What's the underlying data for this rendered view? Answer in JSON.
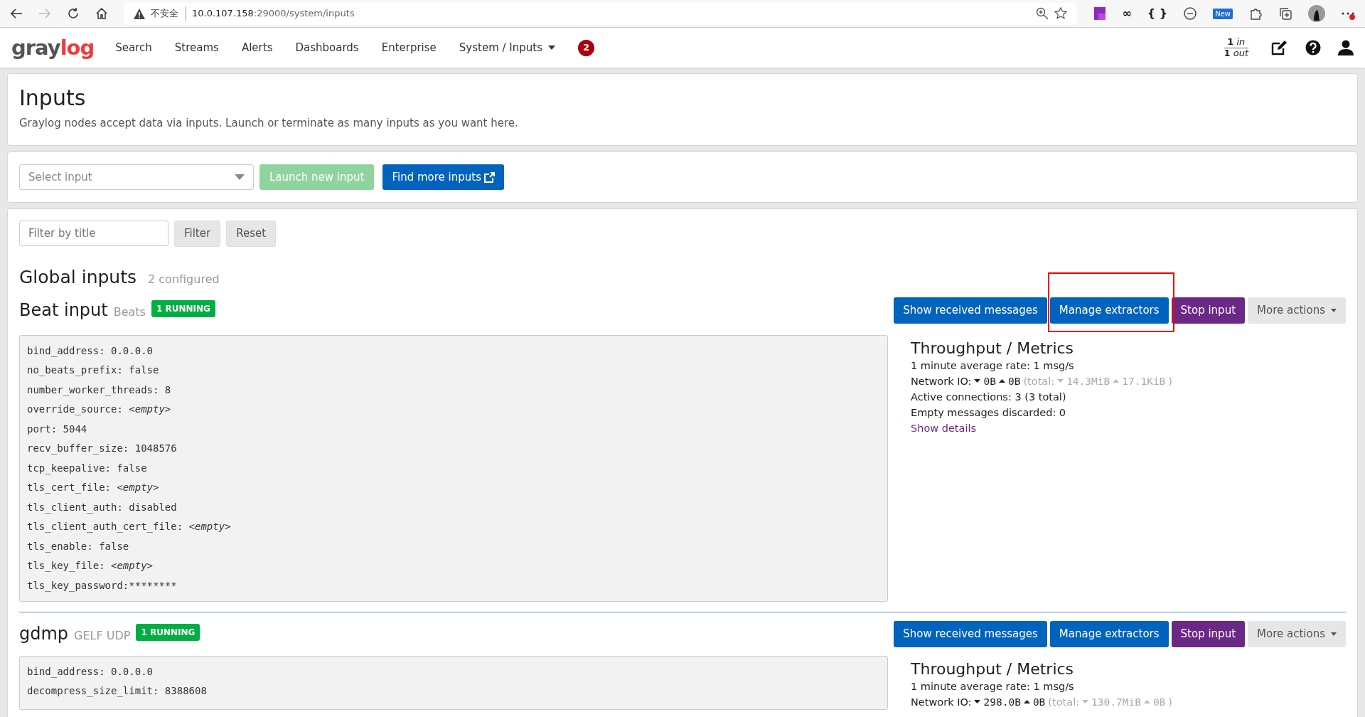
{
  "browser": {
    "security_label": "不安全",
    "url_host": "10.0.107.158",
    "url_path": ":29000/system/inputs",
    "extension_labels": [
      "∞",
      "{ }"
    ],
    "new_badge": "New"
  },
  "nav": {
    "logo_dark": "gray",
    "logo_accent": "log",
    "items": [
      {
        "label": "Search",
        "dropdown": false
      },
      {
        "label": "Streams",
        "dropdown": false
      },
      {
        "label": "Alerts",
        "dropdown": false
      },
      {
        "label": "Dashboards",
        "dropdown": false
      },
      {
        "label": "Enterprise",
        "dropdown": false
      },
      {
        "label": "System / Inputs",
        "dropdown": true
      }
    ],
    "notification_count": "2",
    "throughput": {
      "in_count": "1",
      "in_label": "in",
      "out_count": "1",
      "out_label": "out"
    }
  },
  "page_header": {
    "title": "Inputs",
    "description": "Graylog nodes accept data via inputs. Launch or terminate as many inputs as you want here."
  },
  "launcher": {
    "select_placeholder": "Select input",
    "launch_button": {
      "label": "Launch new input",
      "disabled": true
    },
    "find_button": "Find more inputs"
  },
  "filter": {
    "placeholder": "Filter by title",
    "filter_button": "Filter",
    "reset_button": "Reset"
  },
  "section": {
    "title": "Global inputs",
    "count": "2 configured"
  },
  "inputs": [
    {
      "title": "Beat input",
      "type": "Beats",
      "status": "1 RUNNING",
      "actions": [
        {
          "label": "Show received messages",
          "kind": "primary",
          "highlighted": false
        },
        {
          "label": "Manage extractors",
          "kind": "primary",
          "highlighted": true
        },
        {
          "label": "Stop input",
          "kind": "stop",
          "highlighted": false
        },
        {
          "label": "More actions",
          "kind": "more",
          "highlighted": false
        }
      ],
      "config": [
        {
          "key": "bind_address:",
          "value": "0.0.0.0",
          "kind": "plain"
        },
        {
          "key": "no_beats_prefix:",
          "value": "false",
          "kind": "plain"
        },
        {
          "key": "number_worker_threads:",
          "value": "8",
          "kind": "plain"
        },
        {
          "key": "override_source:",
          "value": "<empty>",
          "kind": "empty"
        },
        {
          "key": "port:",
          "value": "5044",
          "kind": "plain"
        },
        {
          "key": "recv_buffer_size:",
          "value": "1048576",
          "kind": "plain"
        },
        {
          "key": "tcp_keepalive:",
          "value": "false",
          "kind": "plain"
        },
        {
          "key": "tls_cert_file:",
          "value": "<empty>",
          "kind": "empty"
        },
        {
          "key": "tls_client_auth:",
          "value": "disabled",
          "kind": "plain"
        },
        {
          "key": "tls_client_auth_cert_file:",
          "value": "<empty>",
          "kind": "empty"
        },
        {
          "key": "tls_enable:",
          "value": "false",
          "kind": "plain"
        },
        {
          "key": "tls_key_file:",
          "value": "<empty>",
          "kind": "empty"
        },
        {
          "key": "tls_key_password:",
          "value": "********",
          "kind": "secret"
        }
      ],
      "metrics": {
        "title": "Throughput / Metrics",
        "rate": "1 minute average rate: 1 msg/s",
        "network": {
          "label": "Network IO:",
          "down": "0B",
          "up": "0B",
          "total_label": "(total:",
          "total_down": "14.3MiB",
          "total_up": "17.1KiB",
          "total_end": ")"
        },
        "lines": [
          "Active connections: 3 (3 total)",
          "Empty messages discarded: 0"
        ],
        "details_link": "Show details"
      }
    },
    {
      "title": "gdmp",
      "type": "GELF UDP",
      "status": "1 RUNNING",
      "actions": [
        {
          "label": "Show received messages",
          "kind": "primary",
          "highlighted": false
        },
        {
          "label": "Manage extractors",
          "kind": "primary",
          "highlighted": false
        },
        {
          "label": "Stop input",
          "kind": "stop",
          "highlighted": false
        },
        {
          "label": "More actions",
          "kind": "more",
          "highlighted": false
        }
      ],
      "config": [
        {
          "key": "bind_address:",
          "value": "0.0.0.0",
          "kind": "plain"
        },
        {
          "key": "decompress_size_limit:",
          "value": "8388608",
          "kind": "plain"
        }
      ],
      "metrics": {
        "title": "Throughput / Metrics",
        "rate": "1 minute average rate: 1 msg/s",
        "network": {
          "label": "Network IO:",
          "down": "298.0B",
          "up": "0B",
          "total_label": "(total:",
          "total_down": "130.7MiB",
          "total_up": "0B",
          "total_end": ")"
        }
      }
    }
  ]
}
